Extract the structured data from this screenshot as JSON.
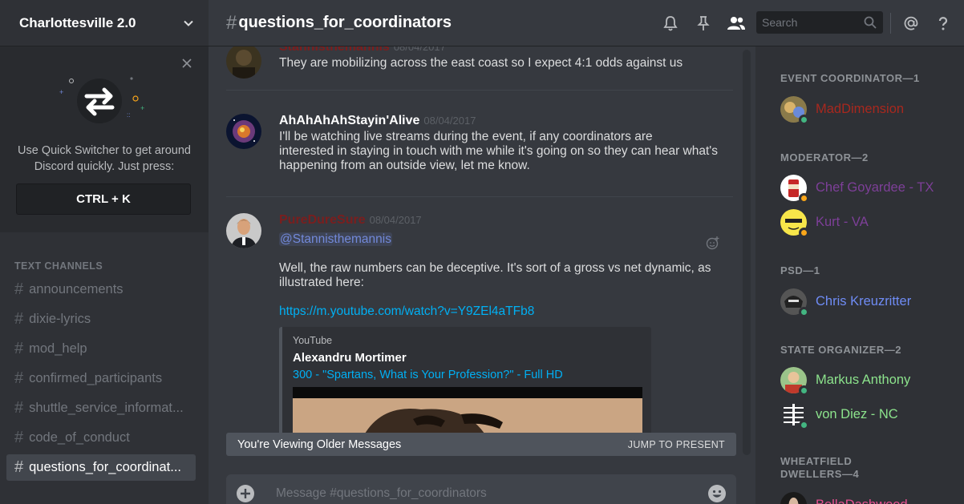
{
  "server": {
    "name": "Charlottesville 2.0"
  },
  "quick_switcher": {
    "text_line1": "Use Quick Switcher to get around",
    "text_line2": "Discord quickly. Just press:",
    "shortcut": "CTRL + K"
  },
  "sidebar": {
    "category": "TEXT CHANNELS",
    "channels": [
      {
        "name": "announcements"
      },
      {
        "name": "dixie-lyrics"
      },
      {
        "name": "mod_help"
      },
      {
        "name": "confirmed_participants"
      },
      {
        "name": "shuttle_service_informat..."
      },
      {
        "name": "code_of_conduct"
      },
      {
        "name": "questions_for_coordinat...",
        "active": true
      }
    ]
  },
  "header": {
    "channel_name": "questions_for_coordinators",
    "search_placeholder": "Search",
    "icons": [
      "bell-icon",
      "pin-icon",
      "members-icon",
      "search-icon",
      "mention-icon",
      "help-icon"
    ]
  },
  "messages": [
    {
      "author": "Stannisthemannis",
      "author_color": "#7a1e1e",
      "timestamp": "08/04/2017",
      "text": "They are mobilizing across the east coast so I expect 4:1 odds against us"
    },
    {
      "author": "AhAhAhAhStayin'Alive",
      "author_color": "#ffffff",
      "timestamp": "08/04/2017",
      "lines": [
        "I'll be watching live streams during the event, if any coordinators are",
        "interested in staying in touch with me while it's going on so they can hear what's",
        "happening from an outside view, let me know."
      ]
    },
    {
      "author": "PureDureSure",
      "author_color": "#7a1e1e",
      "timestamp": "08/04/2017",
      "mention": "@Stannisthemannis",
      "lines": [
        "Well, the raw numbers can be deceptive. It's sort of a gross vs net dynamic, as",
        "illustrated here:"
      ],
      "link": "https://m.youtube.com/watch?v=Y9ZEl4aTFb8",
      "embed": {
        "provider": "YouTube",
        "author": "Alexandru Mortimer",
        "title": "300 - \"Spartans, What is Your Profession?\" - Full HD"
      }
    }
  ],
  "older_messages_bar": {
    "label": "You're Viewing Older Messages",
    "action": "JUMP TO PRESENT"
  },
  "composer": {
    "placeholder": "Message #questions_for_coordinators"
  },
  "member_list": {
    "groups": [
      {
        "role": "EVENT COORDINATOR—1",
        "members": [
          {
            "name": "MadDimension",
            "color": "#a8281e",
            "status": "online"
          }
        ]
      },
      {
        "role": "MODERATOR—2",
        "members": [
          {
            "name": "Chef Goyardee - TX",
            "color": "#7d3f98",
            "status": "idle"
          },
          {
            "name": "Kurt - VA",
            "color": "#7d3f98",
            "status": "idle"
          }
        ]
      },
      {
        "role": "PSD—1",
        "members": [
          {
            "name": "Chris Kreuzritter",
            "color": "#6f8cf5",
            "status": "online"
          }
        ]
      },
      {
        "role": "STATE ORGANIZER—2",
        "members": [
          {
            "name": "Markus Anthony",
            "color": "#8ce38c",
            "status": "online"
          },
          {
            "name": "von Diez - NC",
            "color": "#8ce38c",
            "status": "online"
          }
        ]
      },
      {
        "role_line1": "WHEATFIELD",
        "role_line2": "DWELLERS—4",
        "members": [
          {
            "name": "BellaDashwood",
            "color": "#e54e8f",
            "status": "online"
          }
        ]
      }
    ]
  }
}
